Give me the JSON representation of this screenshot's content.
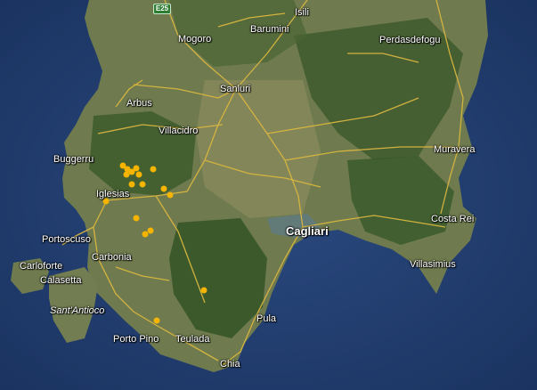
{
  "map": {
    "type": "satellite",
    "region_labels": [
      {
        "id": "isili",
        "text": "Isili"
      },
      {
        "id": "mogoro",
        "text": "Mogoro"
      },
      {
        "id": "barumini",
        "text": "Barumini"
      },
      {
        "id": "perdasdefogu",
        "text": "Perdasdefogu"
      },
      {
        "id": "sanluri",
        "text": "Sanluri"
      },
      {
        "id": "arbus",
        "text": "Arbus"
      },
      {
        "id": "villacidro",
        "text": "Villacidro"
      },
      {
        "id": "buggerru",
        "text": "Buggerru"
      },
      {
        "id": "muravera",
        "text": "Muravera"
      },
      {
        "id": "iglesias",
        "text": "Iglesias"
      },
      {
        "id": "cagliari",
        "text": "Cagliari"
      },
      {
        "id": "costa-rei",
        "text": "Costa Rei"
      },
      {
        "id": "portoscuso",
        "text": "Portoscuso"
      },
      {
        "id": "carbonia",
        "text": "Carbonia"
      },
      {
        "id": "villasimius",
        "text": "Villasimius"
      },
      {
        "id": "carloforte",
        "text": "Carloforte"
      },
      {
        "id": "calasetta",
        "text": "Calasetta"
      },
      {
        "id": "santantioco",
        "text": "Sant'Antioco"
      },
      {
        "id": "pula",
        "text": "Pula"
      },
      {
        "id": "porto-pino",
        "text": "Porto Pino"
      },
      {
        "id": "teulada",
        "text": "Teulada"
      },
      {
        "id": "chia",
        "text": "Chia"
      }
    ],
    "road_shield": "E25",
    "marker_color": "#f4b400",
    "road_color": "#d9b640",
    "sea_color": "#1f3a6b",
    "land_color": "#6b7a4a",
    "marker_count": 17
  }
}
